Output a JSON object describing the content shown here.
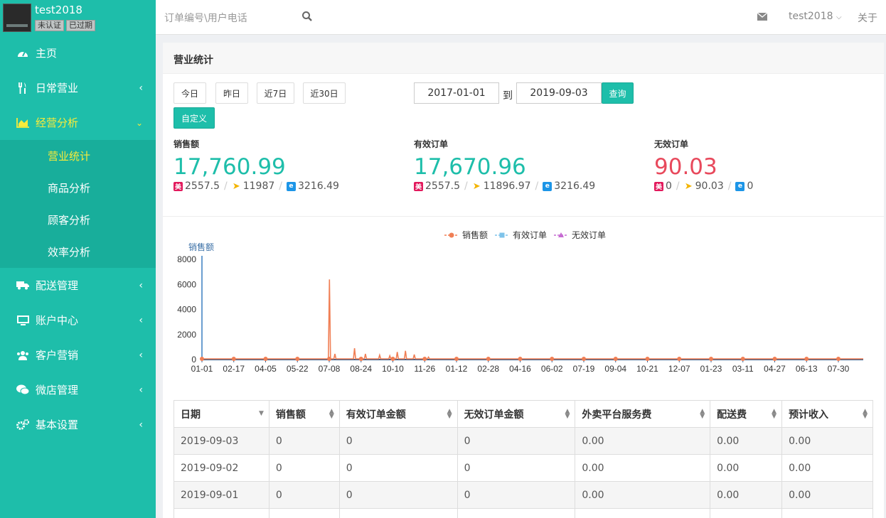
{
  "sidebar": {
    "username": "test2018",
    "badges": [
      "未认证",
      "已过期"
    ],
    "items": [
      {
        "label": "主页",
        "icon": "dashboard-icon"
      },
      {
        "label": "日常营业",
        "icon": "cutlery-icon"
      },
      {
        "label": "经营分析",
        "icon": "area-chart-icon"
      },
      {
        "label": "配送管理",
        "icon": "truck-icon"
      },
      {
        "label": "账户中心",
        "icon": "monitor-icon"
      },
      {
        "label": "客户营销",
        "icon": "users-icon"
      },
      {
        "label": "微店管理",
        "icon": "wechat-icon"
      },
      {
        "label": "基本设置",
        "icon": "cogs-icon"
      }
    ],
    "submenu": [
      "营业统计",
      "商品分析",
      "顾客分析",
      "效率分析"
    ]
  },
  "topbar": {
    "search_placeholder": "订单编号\\用户电话",
    "user": "test2018",
    "about": "关于"
  },
  "panel": {
    "title": "营业统计",
    "quick_buttons": [
      "今日",
      "昨日",
      "近7日",
      "近30日"
    ],
    "custom_button": "自定义",
    "date_from": "2017-01-01",
    "to_label": "到",
    "date_to": "2019-09-03",
    "query_button": "查询"
  },
  "stats": [
    {
      "label": "销售额",
      "value": "17,760.99",
      "color": "#1ebeaa",
      "p1": "2557.5",
      "p2": "11987",
      "p3": "3216.49"
    },
    {
      "label": "有效订单",
      "value": "17,670.96",
      "color": "#1ebeaa",
      "p1": "2557.5",
      "p2": "11896.97",
      "p3": "3216.49"
    },
    {
      "label": "无效订单",
      "value": "90.03",
      "color": "#e8495c",
      "p1": "0",
      "p2": "90.03",
      "p3": "0"
    }
  ],
  "chart_data": {
    "type": "line",
    "ylabel": "销售额",
    "yticks": [
      0,
      2000,
      4000,
      6000,
      8000
    ],
    "ylim": [
      0,
      8000
    ],
    "x_tick_labels": [
      "01-01",
      "02-17",
      "04-05",
      "05-22",
      "07-08",
      "08-24",
      "10-10",
      "11-26",
      "01-12",
      "02-28",
      "04-16",
      "06-02",
      "07-19",
      "09-04",
      "10-21",
      "12-07",
      "01-23",
      "03-11",
      "04-27",
      "06-13",
      "07-30"
    ],
    "x_start": "2017-01-01",
    "x_end": "2019-09-03",
    "series": [
      {
        "name": "销售额",
        "color": "#f07f55",
        "marker": "circle",
        "spikes": [
          {
            "date": "2017-07-08",
            "value": 6400
          },
          {
            "date": "2017-08-14",
            "value": 900
          },
          {
            "date": "2017-07-16",
            "value": 450
          },
          {
            "date": "2017-08-30",
            "value": 450
          },
          {
            "date": "2017-09-20",
            "value": 350
          },
          {
            "date": "2017-10-05",
            "value": 300
          },
          {
            "date": "2017-10-16",
            "value": 600
          },
          {
            "date": "2017-10-28",
            "value": 700
          },
          {
            "date": "2017-11-10",
            "value": 400
          },
          {
            "date": "2017-12-01",
            "value": 200
          }
        ]
      },
      {
        "name": "有效订单",
        "color": "#7ec3ea",
        "marker": "square"
      },
      {
        "name": "无效订单",
        "color": "#c66bd2",
        "marker": "triangle"
      }
    ]
  },
  "table": {
    "columns": [
      "日期",
      "销售额",
      "有效订单金额",
      "无效订单金额",
      "外卖平台服务费",
      "配送费",
      "预计收入"
    ],
    "rows": [
      [
        "2019-09-03",
        "0",
        "0",
        "0",
        "0.00",
        "0.00",
        "0.00"
      ],
      [
        "2019-09-02",
        "0",
        "0",
        "0",
        "0.00",
        "0.00",
        "0.00"
      ],
      [
        "2019-09-01",
        "0",
        "0",
        "0",
        "0.00",
        "0.00",
        "0.00"
      ]
    ]
  }
}
